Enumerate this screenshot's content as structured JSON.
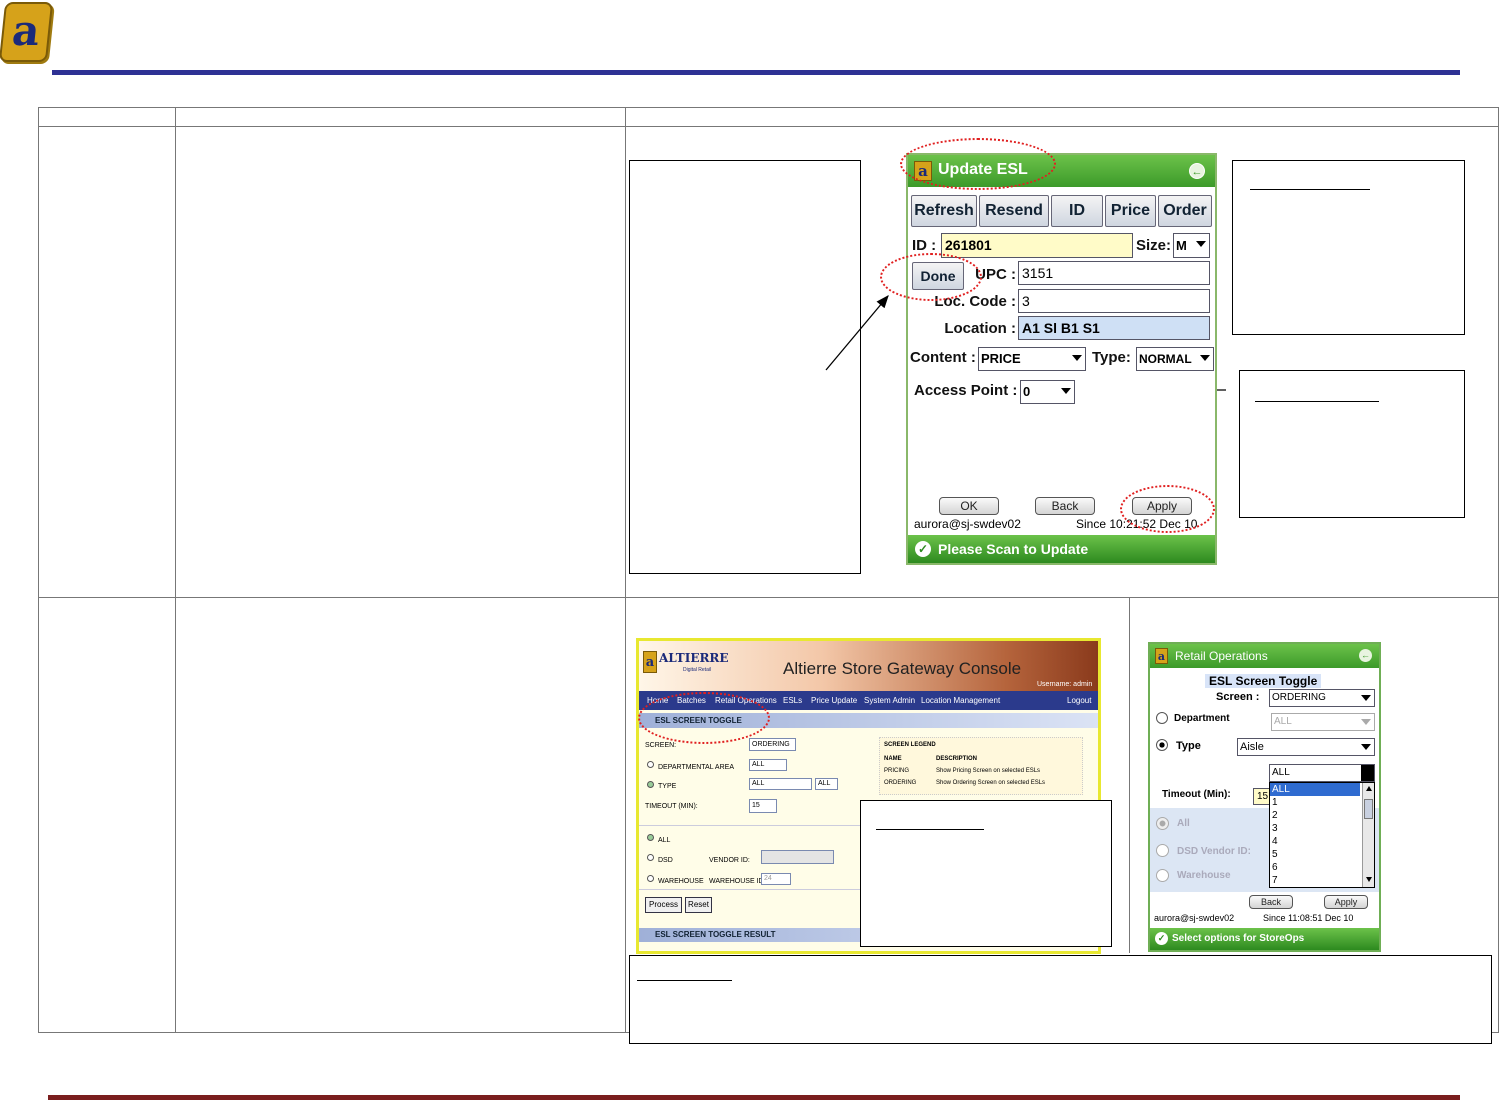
{
  "header": {
    "logo_letter": "a"
  },
  "update_esl": {
    "title": "Update ESL",
    "buttons": [
      "Refresh",
      "Resend",
      "ID",
      "Price",
      "Order"
    ],
    "id_label": "ID :",
    "id_value": "261801",
    "size_label": "Size:",
    "size_value": "M",
    "done_label": "Done",
    "upc_label": "UPC :",
    "upc_value": "3151",
    "loc_code_label": "Loc. Code :",
    "loc_code_value": "3",
    "location_label": "Location :",
    "location_value": "A1 Sl B1 S1",
    "content_label": "Content :",
    "content_value": "PRICE",
    "type_label": "Type:",
    "type_value": "NORMAL",
    "access_point_label": "Access Point :",
    "access_point_value": "0",
    "ok_label": "OK",
    "back_label": "Back",
    "apply_label": "Apply",
    "user": "aurora@sj-swdev02",
    "since": "Since 10:21:52 Dec 10",
    "status": "Please Scan to Update"
  },
  "console": {
    "logo": "ALTIERRE",
    "logo_sub": "Digital Retail",
    "title": "Altierre Store Gateway Console",
    "username": "Username: admin",
    "nav": [
      "Home",
      "Batches",
      "Retail Operations",
      "ESLs",
      "Price Update",
      "System Admin",
      "Location Management"
    ],
    "logout": "Logout",
    "section": "ESL SCREEN TOGGLE",
    "screen_label": "SCREEN:",
    "screen_value": "ORDERING",
    "dept_label": "DEPARTMENTAL AREA",
    "dept_value": "ALL",
    "type_label": "TYPE",
    "type_value": "ALL",
    "type_value2": "ALL",
    "timeout_label": "TIMEOUT (MIN):",
    "timeout_value": "15",
    "all_label": "ALL",
    "dsd_label": "DSD",
    "vendor_label": "VENDOR ID:",
    "warehouse_label": "WAREHOUSE",
    "warehouse_id_label": "WAREHOUSE ID:",
    "warehouse_id_value": "24",
    "process_label": "Process",
    "reset_label": "Reset",
    "result_section": "ESL SCREEN TOGGLE RESULT",
    "legend_title": "SCREEN LEGEND",
    "legend_name_h": "NAME",
    "legend_desc_h": "DESCRIPTION",
    "legend_rows": [
      {
        "name": "PRICING",
        "desc": "Show Pricing Screen on selected ESLs"
      },
      {
        "name": "ORDERING",
        "desc": "Show Ordering Screen on selected ESLs"
      }
    ]
  },
  "retail_ops": {
    "title": "Retail Operations",
    "subtitle": "ESL Screen Toggle",
    "screen_label": "Screen :",
    "screen_value": "ORDERING",
    "department_label": "Department",
    "department_value": "ALL",
    "type_label": "Type",
    "type_value": "Aisle",
    "list_header": "ALL",
    "list_items": [
      "ALL",
      "1",
      "2",
      "3",
      "4",
      "5",
      "6",
      "7"
    ],
    "timeout_label": "Timeout (Min):",
    "timeout_value": "15",
    "all_label": "All",
    "dsd_label": "DSD  Vendor ID:",
    "warehouse_label": "Warehouse",
    "back_label": "Back",
    "apply_label": "Apply",
    "user": "aurora@sj-swdev02",
    "since": "Since 11:08:51 Dec 10",
    "status": "Select options for StoreOps"
  }
}
